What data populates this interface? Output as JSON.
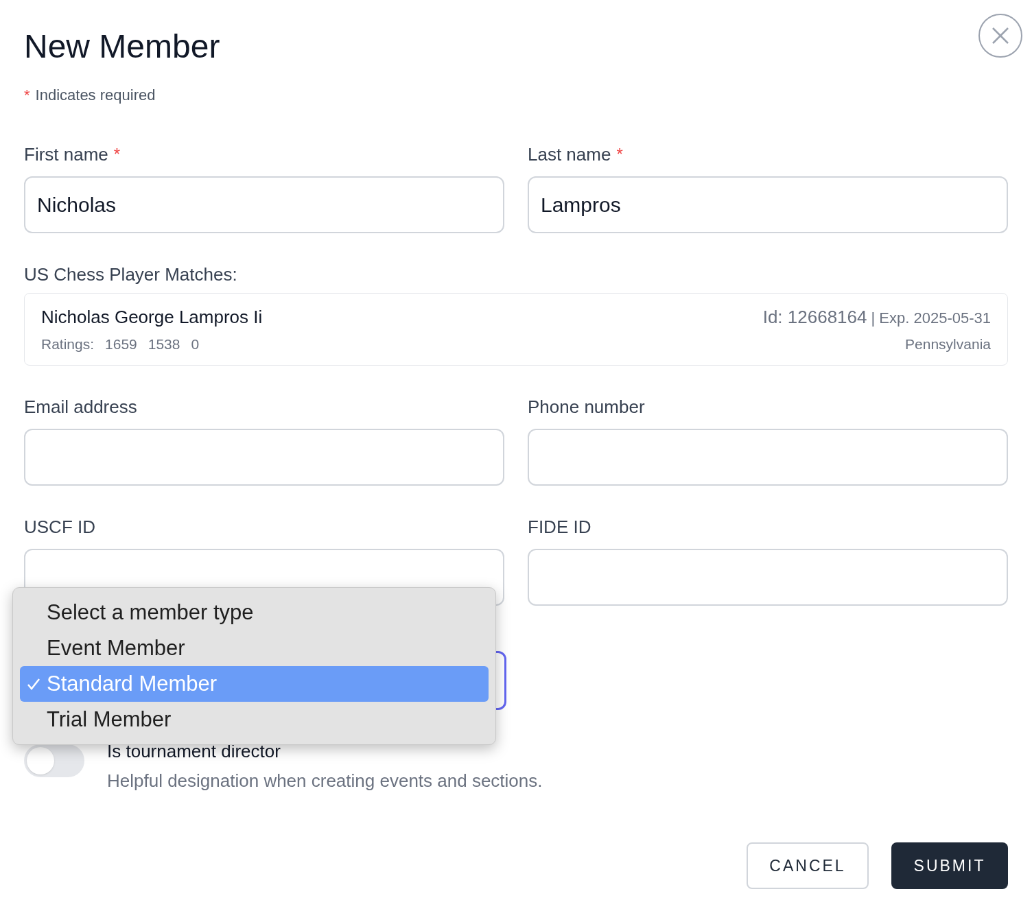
{
  "title": "New Member",
  "required_note": {
    "mark": "*",
    "text": "Indicates required"
  },
  "name_fields": [
    {
      "label": "First name",
      "required": true,
      "value": "Nicholas"
    },
    {
      "label": "Last name",
      "required": true,
      "value": "Lampros"
    }
  ],
  "matches": {
    "label": "US Chess Player Matches:",
    "results": [
      {
        "name": "Nicholas George Lampros Ii",
        "ratings_label": "Ratings:",
        "ratings": [
          "1659",
          "1538",
          "0"
        ],
        "id": "Id: 12668164",
        "exp": "| Exp. 2025-05-31",
        "state": "Pennsylvania"
      }
    ]
  },
  "contact_fields": [
    {
      "label": "Email address",
      "required": false
    },
    {
      "label": "Phone number",
      "required": false
    },
    {
      "label": "USCF ID",
      "required": false
    },
    {
      "label": "FIDE ID",
      "required": false
    }
  ],
  "member_type": {
    "open": true,
    "options": [
      {
        "label": "Select a member type",
        "selected": false
      },
      {
        "label": "Event Member",
        "selected": false
      },
      {
        "label": "Standard Member",
        "selected": true
      },
      {
        "label": "Trial Member",
        "selected": false
      }
    ]
  },
  "director_toggle": {
    "label": "Is tournament director",
    "description": "Helpful designation when creating events and sections.",
    "on": false
  },
  "buttons": [
    {
      "label": "CANCEL",
      "kind": "secondary"
    },
    {
      "label": "SUBMIT",
      "kind": "primary"
    }
  ]
}
